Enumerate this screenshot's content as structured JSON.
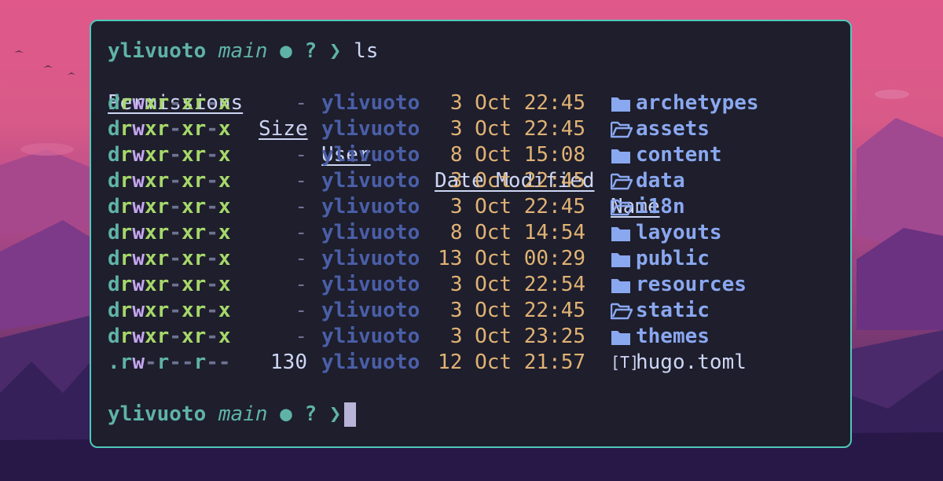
{
  "colors": {
    "border": "#4ec9b8",
    "terminal_bg": "#1e1e2c",
    "prompt": "#5fb3a6",
    "user": "#4a5fa8",
    "date": "#e0b274",
    "folder": "#8aa8f0"
  },
  "prompt": {
    "user": "ylivuoto",
    "branch": "main",
    "dot": "●",
    "status": "?",
    "arrow": "❯",
    "command": "ls"
  },
  "headers": {
    "permissions": "Permissions",
    "size": "Size",
    "user": "User",
    "date_modified": "Date Modified",
    "name": "Name"
  },
  "entries": [
    {
      "perm": "drwxr-xr-x",
      "size": "-",
      "user": "ylivuoto",
      "date": "3 Oct 22:45",
      "icon": "folder-icon",
      "name": "archetypes"
    },
    {
      "perm": "drwxr-xr-x",
      "size": "-",
      "user": "ylivuoto",
      "date": "3 Oct 22:45",
      "icon": "folder-open-icon",
      "name": "assets"
    },
    {
      "perm": "drwxr-xr-x",
      "size": "-",
      "user": "ylivuoto",
      "date": "8 Oct 15:08",
      "icon": "folder-icon",
      "name": "content"
    },
    {
      "perm": "drwxr-xr-x",
      "size": "-",
      "user": "ylivuoto",
      "date": "3 Oct 22:45",
      "icon": "folder-open-icon",
      "name": "data"
    },
    {
      "perm": "drwxr-xr-x",
      "size": "-",
      "user": "ylivuoto",
      "date": "3 Oct 22:45",
      "icon": "folder-open-icon",
      "name": "i18n"
    },
    {
      "perm": "drwxr-xr-x",
      "size": "-",
      "user": "ylivuoto",
      "date": "8 Oct 14:54",
      "icon": "folder-icon",
      "name": "layouts"
    },
    {
      "perm": "drwxr-xr-x",
      "size": "-",
      "user": "ylivuoto",
      "date": "13 Oct 00:29",
      "icon": "folder-icon",
      "name": "public"
    },
    {
      "perm": "drwxr-xr-x",
      "size": "-",
      "user": "ylivuoto",
      "date": "3 Oct 22:54",
      "icon": "folder-icon",
      "name": "resources"
    },
    {
      "perm": "drwxr-xr-x",
      "size": "-",
      "user": "ylivuoto",
      "date": "3 Oct 22:45",
      "icon": "folder-open-icon",
      "name": "static"
    },
    {
      "perm": "drwxr-xr-x",
      "size": "-",
      "user": "ylivuoto",
      "date": "3 Oct 23:25",
      "icon": "folder-icon",
      "name": "themes"
    },
    {
      "perm": ".rw-r--r--",
      "size": "130",
      "user": "ylivuoto",
      "date": "12 Oct 21:57",
      "icon": "toml-file-icon",
      "name": "hugo.toml"
    }
  ],
  "toml_icon_glyph": "[T]",
  "second_prompt": {
    "user": "ylivuoto",
    "branch": "main",
    "dot": "●",
    "status": "?",
    "arrow": "❯"
  }
}
